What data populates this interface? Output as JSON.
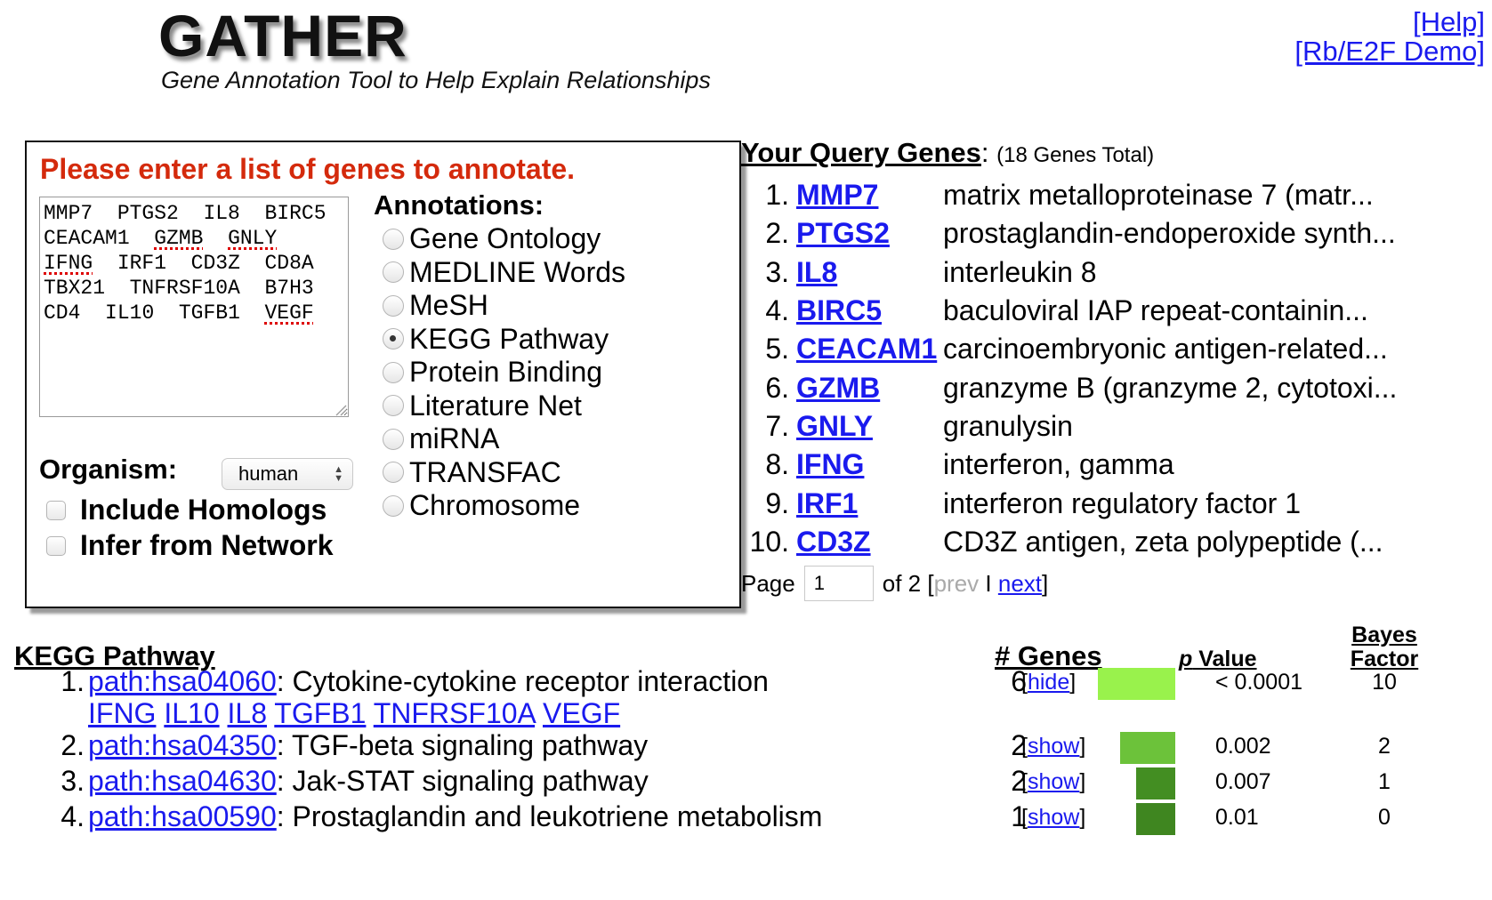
{
  "header": {
    "logo": "GATHER",
    "tagline": "Gene Annotation Tool to Help Explain Relationships",
    "help_link": "[Help]",
    "demo_link": "[Rb/E2F Demo]"
  },
  "form": {
    "prompt": "Please enter a list of genes to annotate.",
    "gene_lines": [
      [
        "MMP7",
        "PTGS2",
        "IL8",
        "BIRC5"
      ],
      [
        "CEACAM1",
        "GZMB",
        "GNLY"
      ],
      [
        "IFNG",
        "IRF1",
        "CD3Z",
        "CD8A"
      ],
      [
        "TBX21",
        "TNFRSF10A",
        "B7H3"
      ],
      [
        "CD4",
        "IL10",
        "TGFB1",
        "VEGF"
      ]
    ],
    "annotations_label": "Annotations:",
    "annotation_options": [
      {
        "label": "Gene Ontology",
        "selected": false
      },
      {
        "label": "MEDLINE Words",
        "selected": false
      },
      {
        "label": "MeSH",
        "selected": false
      },
      {
        "label": "KEGG Pathway",
        "selected": true
      },
      {
        "label": "Protein Binding",
        "selected": false
      },
      {
        "label": "Literature Net",
        "selected": false
      },
      {
        "label": "miRNA",
        "selected": false
      },
      {
        "label": "TRANSFAC",
        "selected": false
      },
      {
        "label": "Chromosome",
        "selected": false
      }
    ],
    "organism_label": "Organism:",
    "organism_value": "human",
    "include_homologs_label": "Include Homologs",
    "include_homologs_checked": false,
    "infer_network_label": "Infer from Network",
    "infer_network_checked": false
  },
  "query": {
    "title": "Your Query Genes",
    "colon": ":",
    "total": "(18 Genes Total)",
    "genes": [
      {
        "num": "1.",
        "symbol": "MMP7",
        "desc": "matrix metalloproteinase 7 (matr..."
      },
      {
        "num": "2.",
        "symbol": "PTGS2",
        "desc": "prostaglandin-endoperoxide synth..."
      },
      {
        "num": "3.",
        "symbol": "IL8",
        "desc": "interleukin 8"
      },
      {
        "num": "4.",
        "symbol": "BIRC5",
        "desc": "baculoviral IAP repeat-containin..."
      },
      {
        "num": "5.",
        "symbol": "CEACAM1",
        "desc": "carcinoembryonic antigen-related..."
      },
      {
        "num": "6.",
        "symbol": "GZMB",
        "desc": "granzyme B (granzyme 2, cytotoxi..."
      },
      {
        "num": "7.",
        "symbol": "GNLY",
        "desc": "granulysin"
      },
      {
        "num": "8.",
        "symbol": "IFNG",
        "desc": "interferon, gamma"
      },
      {
        "num": "9.",
        "symbol": "IRF1",
        "desc": "interferon regulatory factor 1"
      },
      {
        "num": "10.",
        "symbol": "CD3Z",
        "desc": "CD3Z antigen, zeta polypeptide (..."
      }
    ],
    "page_label": "Page",
    "page_value": "1",
    "of_label": "of 2",
    "open_bracket": "[",
    "prev_label": "prev",
    "separator": "I",
    "next_label": "next",
    "close_bracket": "]"
  },
  "results": {
    "title": "KEGG Pathway",
    "col_genes": "# Genes",
    "col_p_italic": "p",
    "col_p_rest": " Value",
    "col_bayes": "Bayes Factor",
    "rows": [
      {
        "num": "1.",
        "path": "path:hsa04060",
        "name": ": Cytokine-cytokine receptor interaction",
        "count": "6",
        "toggle": "hide",
        "p": "< 0.0001",
        "bayes": "10",
        "bar_color": "#99f24c",
        "genes": [
          "IFNG",
          "IL10",
          "IL8",
          "TGFB1",
          "TNFRSF10A",
          "VEGF"
        ]
      },
      {
        "num": "2.",
        "path": "path:hsa04350",
        "name": ": TGF-beta signaling pathway",
        "count": "2",
        "toggle": "show",
        "p": "0.002",
        "bayes": "2",
        "bar_color": "#6cc23a"
      },
      {
        "num": "3.",
        "path": "path:hsa04630",
        "name": ": Jak-STAT signaling pathway",
        "count": "2",
        "toggle": "show",
        "p": "0.007",
        "bayes": "1",
        "bar_color": "#438e22"
      },
      {
        "num": "4.",
        "path": "path:hsa00590",
        "name": ": Prostaglandin and leukotriene metabolism",
        "count": "1",
        "toggle": "show",
        "p": "0.01",
        "bayes": "0",
        "bar_color": "#3f8620"
      }
    ]
  }
}
